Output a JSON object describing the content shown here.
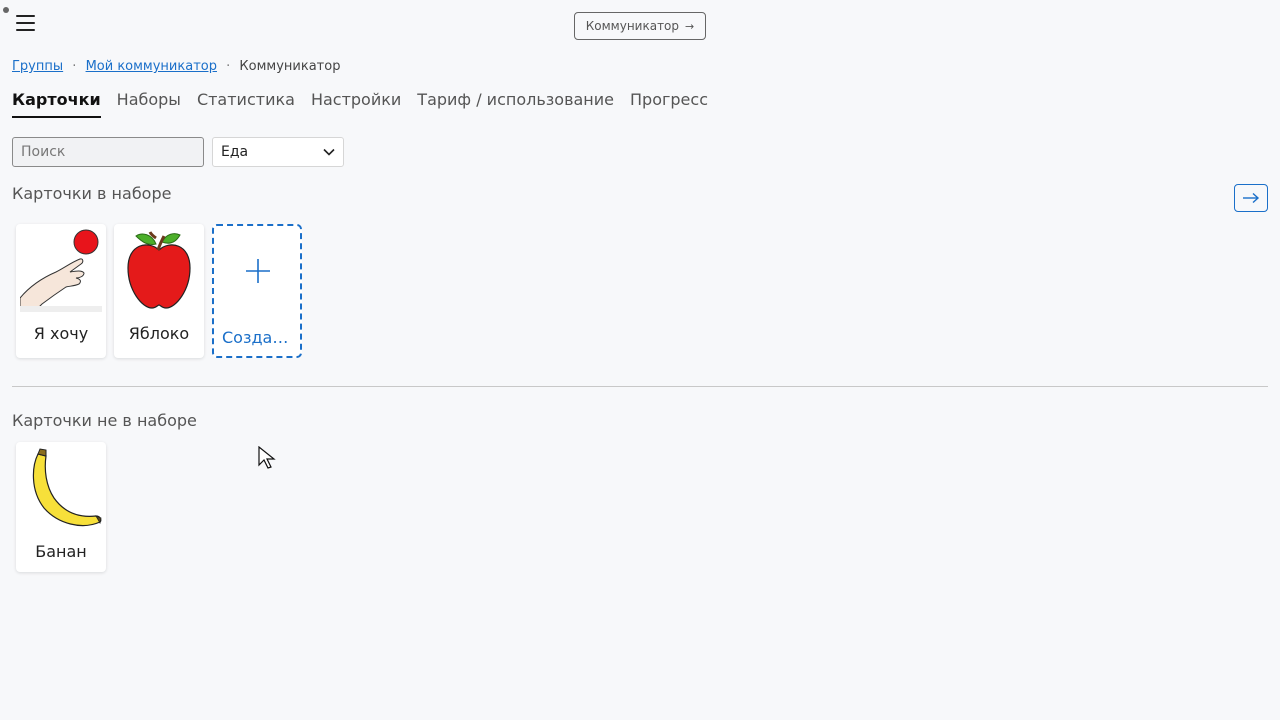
{
  "header": {
    "communicator_button": "Коммуникатор",
    "communicator_arrow": "→"
  },
  "breadcrumb": {
    "items": [
      "Группы",
      "Мой коммуникатор"
    ],
    "current": "Коммуникатор",
    "separator": "·"
  },
  "tabs": [
    {
      "label": "Карточки",
      "active": true
    },
    {
      "label": "Наборы",
      "active": false
    },
    {
      "label": "Статистика",
      "active": false
    },
    {
      "label": "Настройки",
      "active": false
    },
    {
      "label": "Тариф / использование",
      "active": false
    },
    {
      "label": "Прогресс",
      "active": false
    }
  ],
  "filters": {
    "search_placeholder": "Поиск",
    "category_selected": "Еда"
  },
  "in_set": {
    "title": "Карточки в наборе",
    "cards": [
      {
        "label": "Я хочу",
        "icon": "hand-wanting-icon"
      },
      {
        "label": "Яблоко",
        "icon": "apple-icon"
      }
    ],
    "create_label": "Создать карточку"
  },
  "not_in_set": {
    "title": "Карточки не в наборе",
    "cards": [
      {
        "label": "Банан",
        "icon": "banana-icon"
      }
    ]
  },
  "colors": {
    "accent": "#1a6fc9",
    "background": "#f7f8fa"
  }
}
